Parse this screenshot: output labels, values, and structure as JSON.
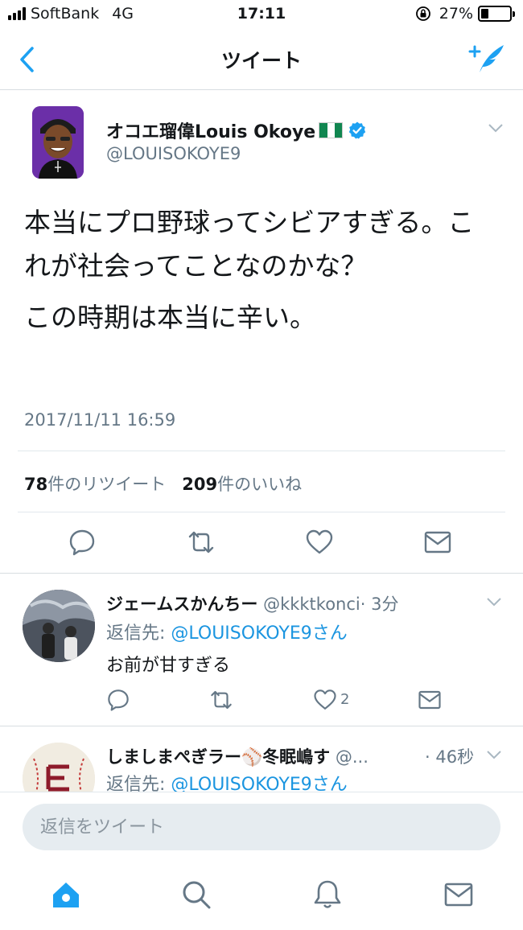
{
  "status_bar": {
    "carrier": "SoftBank",
    "network": "4G",
    "time": "17:11",
    "battery": "27%",
    "battery_level": 0.27
  },
  "nav": {
    "title": "ツイート",
    "back_icon": "chevron-left-icon",
    "compose_icon": "compose-tweet-icon"
  },
  "colors": {
    "accent": "#1da1f2",
    "text": "#14171a",
    "secondary": "#657786",
    "input_bg": "#e6ecf0"
  },
  "tweet": {
    "author_name": "オコエ瑠偉Louis Okoye",
    "author_handle": "@LOUISOKOYE9",
    "text_lines": [
      "本当にプロ野球ってシビアすぎる。これが社会ってことなのかな？",
      "この時期は本当に辛い。"
    ],
    "timestamp": "2017/11/11 16:59",
    "retweet_count": "78",
    "retweet_label": "件のリツイート",
    "like_count": "209",
    "like_label": "件のいいね"
  },
  "replies": [
    {
      "name": "ジェームスかんちー",
      "handle": "@kkktkonci",
      "time": "· 3分",
      "reply_to_prefix": "返信先: ",
      "reply_to": "@LOUISOKOYE9さん",
      "text": "お前が甘すぎる",
      "like_count": "2"
    },
    {
      "name": "しましまぺぎラー⚾冬眠嶋す",
      "handle": "@...",
      "time": "· 46秒",
      "reply_to_prefix": "返信先: ",
      "reply_to": "@LOUISOKOYE9さん"
    }
  ],
  "reply_bar": {
    "placeholder": "返信をツイート"
  },
  "tab_bar": {
    "items": [
      "home-icon",
      "search-icon",
      "notifications-icon",
      "messages-icon"
    ]
  }
}
